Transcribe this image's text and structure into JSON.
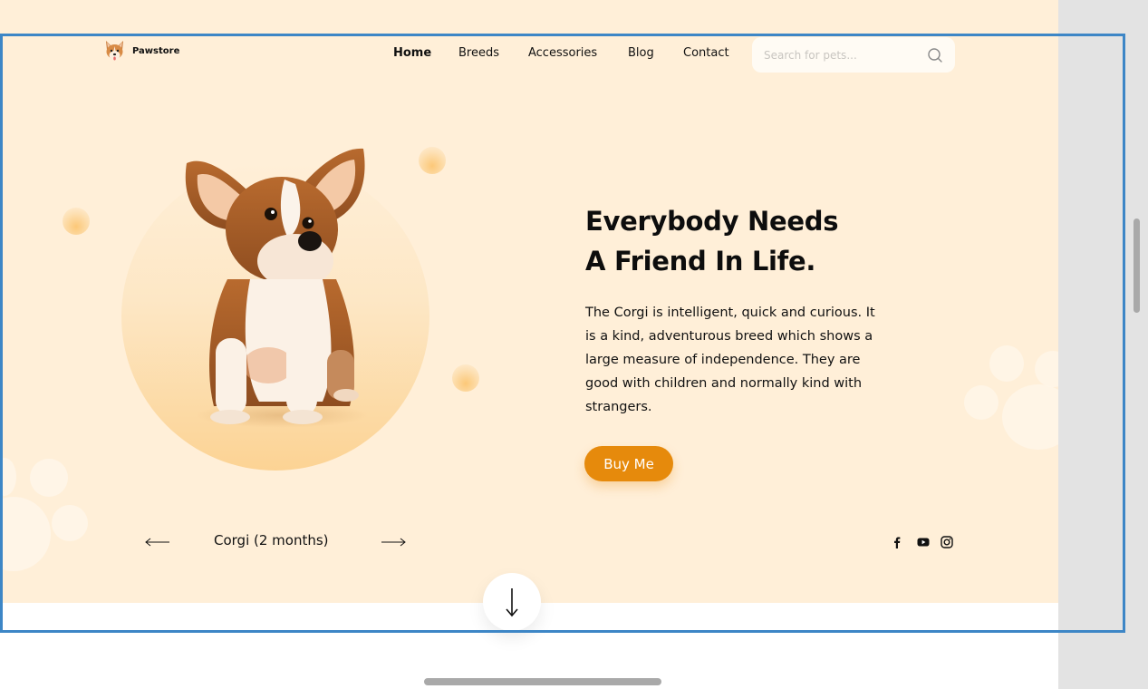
{
  "brand": {
    "name": "Pawstore",
    "logo_icon": "corgi-face-icon"
  },
  "nav": {
    "items": [
      {
        "label": "Home",
        "active": true
      },
      {
        "label": "Breeds",
        "active": false
      },
      {
        "label": "Accessories",
        "active": false
      },
      {
        "label": "Blog",
        "active": false
      },
      {
        "label": "Contact",
        "active": false
      }
    ]
  },
  "search": {
    "placeholder": "Search for pets...",
    "value": "",
    "icon": "search-icon"
  },
  "hero": {
    "title_line1": "Everybody Needs",
    "title_line2": "A Friend In Life.",
    "description": "The Corgi is intelligent, quick and curious. It is a kind, adventurous breed which shows a large measure of independence. They are good with children and normally kind with strangers.",
    "cta_label": "Buy Me",
    "image": "corgi-puppy"
  },
  "carousel": {
    "caption": "Corgi (2 months)",
    "prev_icon": "arrow-left-icon",
    "next_icon": "arrow-right-icon"
  },
  "social": [
    {
      "name": "facebook-icon"
    },
    {
      "name": "youtube-icon"
    },
    {
      "name": "instagram-icon"
    }
  ],
  "scroll_down_icon": "arrow-down-icon",
  "colors": {
    "hero_bg": "#ffefd8",
    "accent": "#e68a0c",
    "text": "#111111",
    "frame": "#3d86c6"
  }
}
